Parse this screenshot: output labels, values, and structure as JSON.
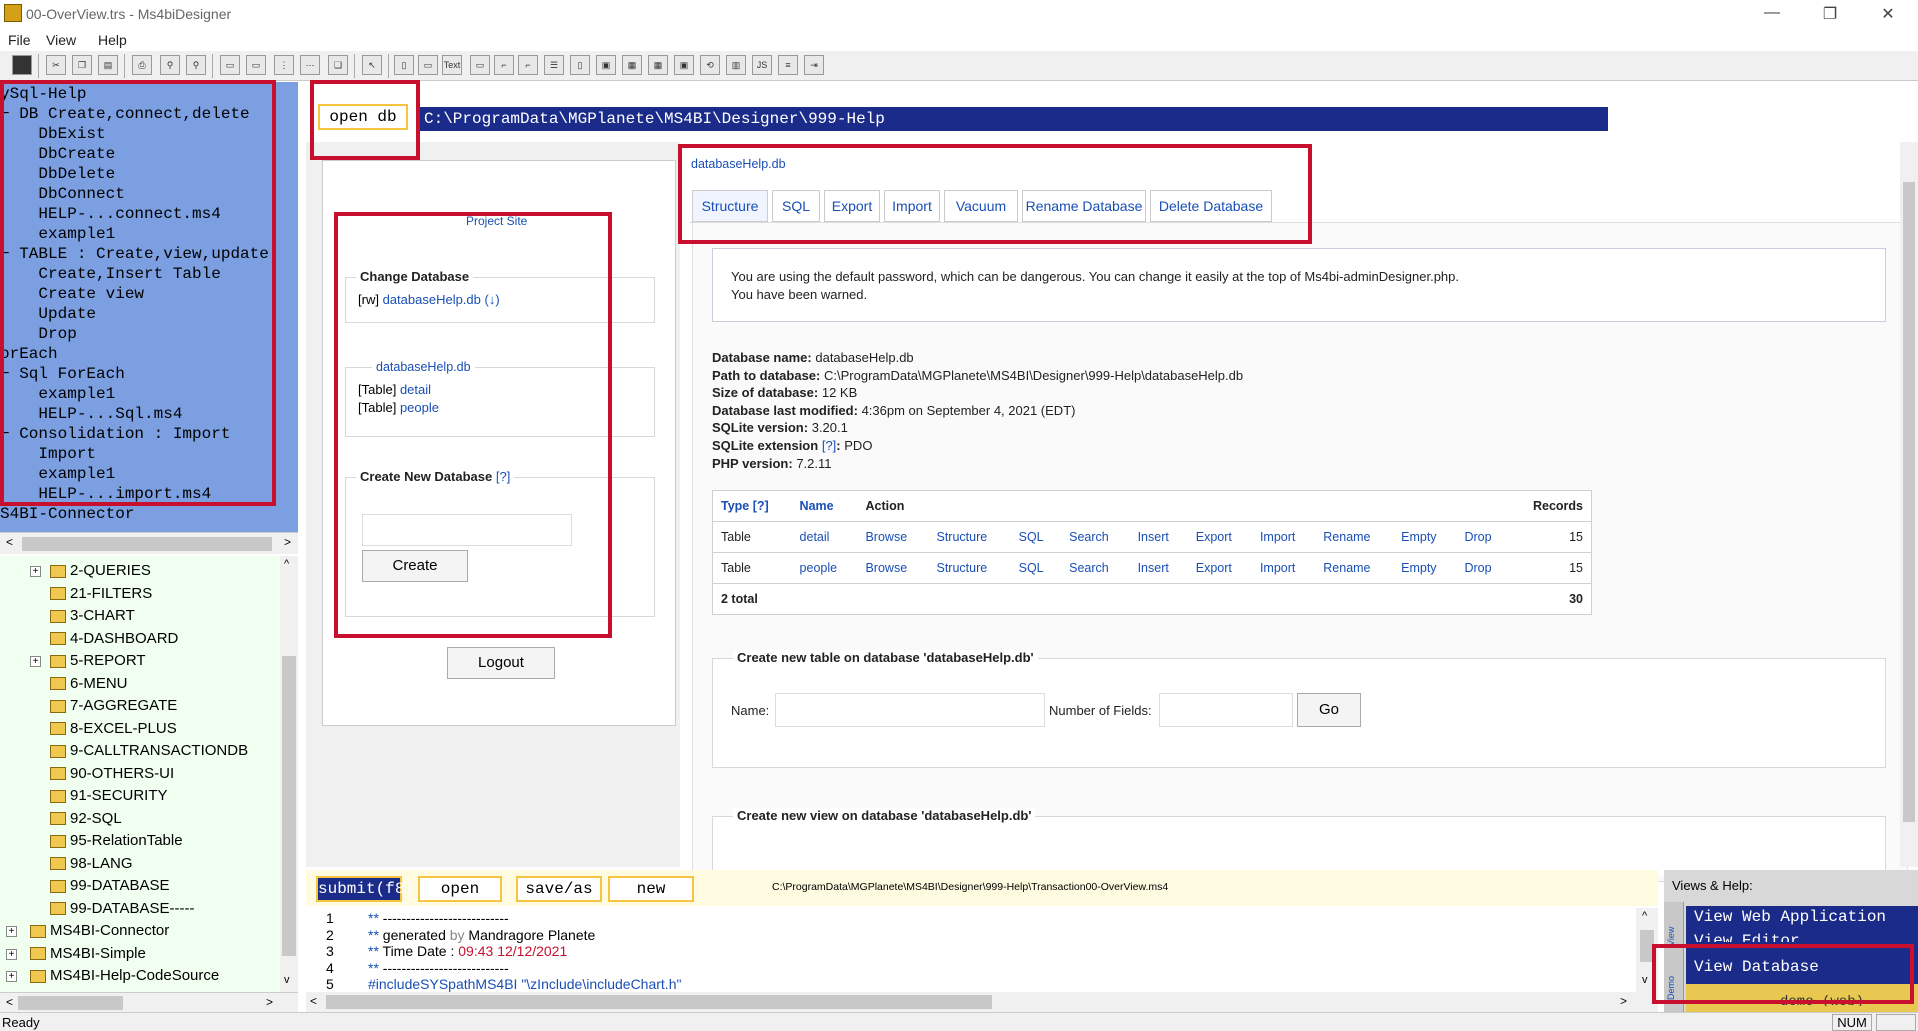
{
  "window": {
    "title": "00-OverView.trs - Ms4biDesigner",
    "minimize": "—",
    "maximize": "❐",
    "close": "✕"
  },
  "menu": [
    "File",
    "View",
    "Help"
  ],
  "toolbar_icons": [
    "save-icon",
    "cut-icon",
    "copy-icon",
    "paste-icon",
    "print-icon",
    "pin-icon",
    "pin2-icon",
    "frame-icon",
    "frame2-icon",
    "grid-icon",
    "grid2-icon",
    "layers-icon",
    "pointer-icon",
    "textbox-icon",
    "box-icon",
    "text-icon",
    "button-icon",
    "link-icon",
    "tag-icon",
    "listbox-icon",
    "panel-icon",
    "table-icon",
    "table2-icon",
    "form-icon",
    "refresh-icon",
    "chart-icon",
    "php-icon",
    "database-icon",
    "exit-icon"
  ],
  "toolbar_text_label": "Text",
  "left_tree": [
    "ySql-Help",
    "− DB Create,connect,delete",
    "    DbExist",
    "    DbCreate",
    "    DbDelete",
    "    DbConnect",
    "    HELP-...connect.ms4",
    "    example1",
    "− TABLE : Create,view,update",
    "    Create,Insert Table",
    "    Create view",
    "    Update",
    "    Drop",
    "orEach",
    "− Sql ForEach",
    "    example1",
    "    HELP-...Sql.ms4",
    "− Consolidation : Import",
    "    Import",
    "    example1",
    "    HELP-...import.ms4",
    "S4BI-Connector"
  ],
  "folder_tree": [
    {
      "label": "2-QUERIES",
      "expand": true
    },
    {
      "label": "21-FILTERS",
      "expand": false
    },
    {
      "label": "3-CHART",
      "expand": false
    },
    {
      "label": "4-DASHBOARD",
      "expand": false
    },
    {
      "label": "5-REPORT",
      "expand": true
    },
    {
      "label": "6-MENU",
      "expand": false
    },
    {
      "label": "7-AGGREGATE",
      "expand": false
    },
    {
      "label": "8-EXCEL-PLUS",
      "expand": false
    },
    {
      "label": "9-CALLTRANSACTIONDB",
      "expand": false
    },
    {
      "label": "90-OTHERS-UI",
      "expand": false
    },
    {
      "label": "91-SECURITY",
      "expand": false
    },
    {
      "label": "92-SQL",
      "expand": false
    },
    {
      "label": "95-RelationTable",
      "expand": false
    },
    {
      "label": "98-LANG",
      "expand": false
    },
    {
      "label": "99-DATABASE",
      "expand": false
    },
    {
      "label": "99-DATABASE-----",
      "expand": false
    }
  ],
  "folder_tree_root": [
    "MS4BI-Connector",
    "MS4BI-Simple",
    "MS4BI-Help-CodeSource"
  ],
  "path_bar": {
    "open_db": "open db",
    "path": "C:\\ProgramData\\MGPlanete\\MS4BI\\Designer\\999-Help"
  },
  "left_panel": {
    "project_site": "Project Site",
    "change_db_legend": "Change Database",
    "rw": "[rw]",
    "db_name": "databaseHelp.db",
    "db_link_paren_open": "(",
    "db_link_arrow": "↓",
    "db_link_paren_close": ")",
    "db_box_title": "databaseHelp.db",
    "table_prefix": "[Table]",
    "table1": "detail",
    "table2": "people",
    "create_legend": "Create New Database",
    "create_help": "[?]",
    "create_button": "Create",
    "logout_button": "Logout"
  },
  "right_panel": {
    "db_title": "databaseHelp.db",
    "tabs": [
      "Structure",
      "SQL",
      "Export",
      "Import",
      "Vacuum",
      "Rename Database",
      "Delete Database"
    ],
    "warning_line1": "You are using the default password, which can be dangerous. You can change it easily at the top of Ms4bi-adminDesigner.php.",
    "warning_line2": "You have been warned.",
    "info": [
      {
        "label": "Database name",
        "value": "databaseHelp.db"
      },
      {
        "label": "Path to database",
        "value": "C:\\ProgramData\\MGPlanete\\MS4BI\\Designer\\999-Help\\databaseHelp.db"
      },
      {
        "label": "Size of database",
        "value": "12 KB"
      },
      {
        "label": "Database last modified",
        "value": "4:36pm on September 4, 2021 (EDT)"
      },
      {
        "label": "SQLite version",
        "value": "3.20.1"
      },
      {
        "label": "SQLite extension",
        "value": "PDO",
        "help": "[?]"
      },
      {
        "label": "PHP version",
        "value": "7.2.11"
      }
    ],
    "table_headers": {
      "type": "Type",
      "type_help": "[?]",
      "name": "Name",
      "action": "Action",
      "records": "Records"
    },
    "table_rows": [
      {
        "type": "Table",
        "name": "detail",
        "records": "15"
      },
      {
        "type": "Table",
        "name": "people",
        "records": "15"
      }
    ],
    "actions": [
      "Browse",
      "Structure",
      "SQL",
      "Search",
      "Insert",
      "Export",
      "Import",
      "Rename",
      "Empty",
      "Drop"
    ],
    "total_label": "2 total",
    "total_records": "30",
    "create_table_legend": "Create new table on database 'databaseHelp.db'",
    "name_label": "Name:",
    "fields_label": "Number of Fields:",
    "go_button": "Go",
    "create_view_legend": "Create new view on database 'databaseHelp.db'"
  },
  "bottom_bar": {
    "submit": "submit(f8)",
    "open": "open",
    "save_as": "save/as",
    "new": "new",
    "file_path": "C:\\ProgramData\\MGPlanete\\MS4BI\\Designer\\999-Help\\Transaction00-OverView.ms4"
  },
  "code_lines": [
    {
      "n": "1",
      "stars": "**",
      "rest": " ---------------------------",
      "mid": "",
      "tail": ""
    },
    {
      "n": "2",
      "stars": "**",
      "rest": " generated ",
      "mid": "by",
      "tail": " Mandragore Planete"
    },
    {
      "n": "3",
      "stars": "**",
      "rest": " Time Date : ",
      "mid": "09:43 12/12/2021",
      "tail": ""
    },
    {
      "n": "4",
      "stars": "**",
      "rest": " ---------------------------",
      "mid": "",
      "tail": ""
    },
    {
      "n": "5",
      "stars": "",
      "rest": "#includeSYSpathMS4BI \"\\zInclude\\includeChart.h\"",
      "mid": "",
      "tail": ""
    }
  ],
  "views_help": {
    "title": "Views & Help:",
    "view_web": "View Web Application",
    "view_editor": "View Editor",
    "view_database": "View Database",
    "demo_web": "demo (web)",
    "side_tab1": "View",
    "side_tab2": "Demo"
  },
  "status": {
    "ready": "Ready",
    "num": "NUM"
  },
  "colors": {
    "tree_bg": "#7b9fe0",
    "folder_bg": "#f0fff0",
    "path_bg": "#1b2b8a",
    "highlight_red": "#c8102e",
    "button_border": "#f5c542",
    "link": "#1a4fb5"
  }
}
